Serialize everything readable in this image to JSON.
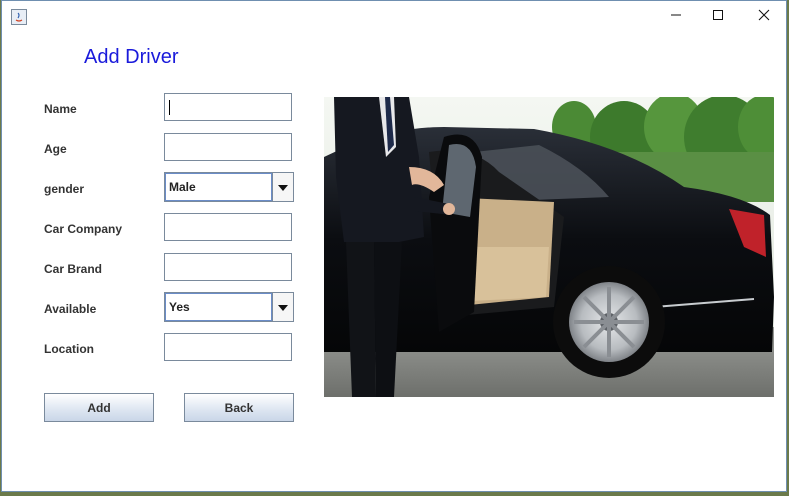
{
  "window": {
    "minimize_glyph": "—",
    "maximize_glyph": "☐",
    "close_glyph": "✕"
  },
  "form": {
    "heading": "Add Driver",
    "labels": {
      "name": "Name",
      "age": "Age",
      "gender": "gender",
      "car_company": "Car Company",
      "car_brand": "Car Brand",
      "available": "Available",
      "location": "Location"
    },
    "values": {
      "name": "",
      "age": "",
      "gender": "Male",
      "car_company": "",
      "car_brand": "",
      "available": "Yes",
      "location": ""
    },
    "buttons": {
      "add": "Add",
      "back": "Back"
    }
  },
  "colors": {
    "heading": "#1a1adb",
    "car_body": "#0c0e12",
    "foliage": "#3f7d2e"
  },
  "icons": [
    "app-icon",
    "minimize-icon",
    "maximize-icon",
    "close-icon",
    "dropdown-arrow-icon"
  ]
}
